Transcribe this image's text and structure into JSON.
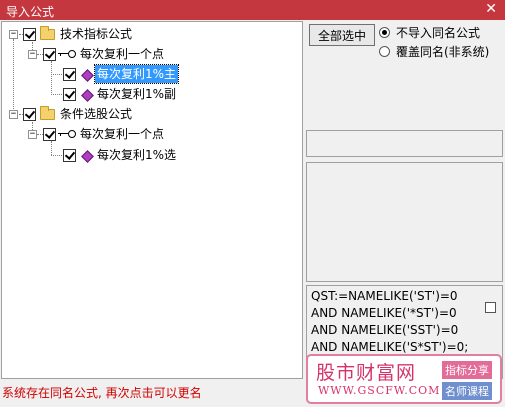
{
  "window": {
    "title": "导入公式",
    "close_glyph": "✕"
  },
  "tree": {
    "groups": [
      {
        "label": "技术指标公式",
        "expander": "−",
        "children": [
          {
            "label": "每次复利一个点",
            "expander": "−",
            "children": [
              {
                "label": "每次复利1%主",
                "selected": true
              },
              {
                "label": "每次复利1%副",
                "selected": false
              }
            ]
          }
        ]
      },
      {
        "label": "条件选股公式",
        "expander": "−",
        "children": [
          {
            "label": "每次复利一个点",
            "expander": "−",
            "children": [
              {
                "label": "每次复利1%选",
                "selected": false
              }
            ]
          }
        ]
      }
    ]
  },
  "options": {
    "select_all_label": "全部选中",
    "radios": [
      {
        "label": "不导入同名公式",
        "checked": true
      },
      {
        "label": "覆盖同名(非系统)",
        "checked": false
      }
    ]
  },
  "formula": {
    "lines": [
      "QST:=NAMELIKE('ST')=0",
      "AND NAMELIKE('*ST')=0",
      "AND NAMELIKE('SST')=0",
      "AND NAMELIKE('S*ST')=0;"
    ]
  },
  "status": {
    "message": "系统存在同名公式, 再次点击可以更名"
  },
  "watermark": {
    "brand": "股市财富网",
    "url": "WWW.GSCFW.COM",
    "tag1": "指标分享",
    "tag2": "名师课程"
  },
  "colors": {
    "title_bar": "#c4373f",
    "selection": "#3399ff",
    "status_text": "#d00000"
  }
}
